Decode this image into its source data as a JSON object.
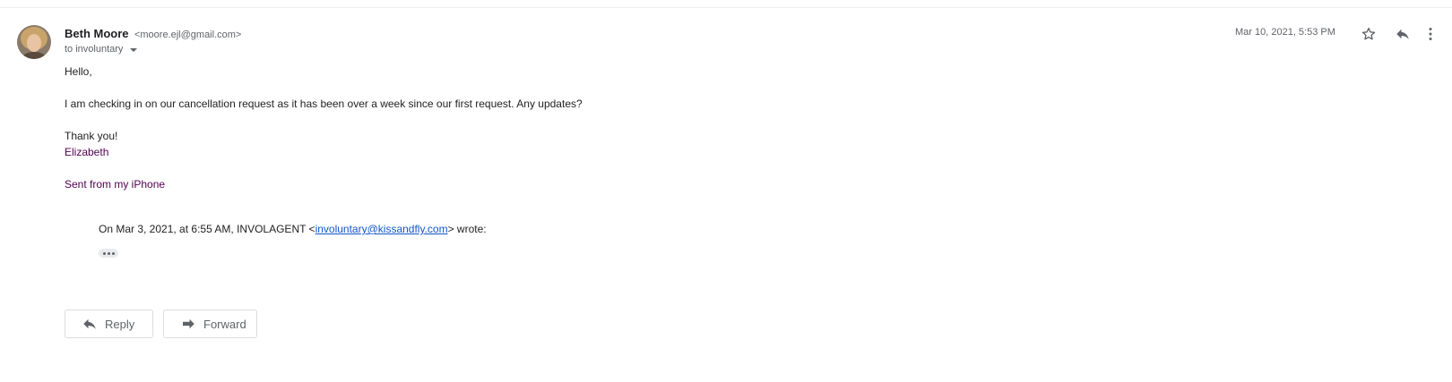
{
  "message": {
    "sender_name": "Beth Moore",
    "sender_email": "<moore.ejl@gmail.com>",
    "recipient": "to involuntary",
    "date": "Mar 10, 2021, 5:53 PM",
    "icons": {
      "avatar": "avatar",
      "star": "star-icon",
      "reply": "reply-icon",
      "more": "more-vert-icon",
      "recipient_caret": "chevron-down-icon"
    }
  },
  "body": {
    "greeting": "Hello,",
    "paragraph": "I am checking in on our cancellation request as it has been over a week since our first request. Any updates?",
    "thanks": "Thank you!",
    "signature_name": "Elizabeth",
    "sent_from": "Sent from my iPhone"
  },
  "quote": {
    "prefix": "On Mar 3, 2021, at 6:55 AM, INVOLAGENT <",
    "link_email": "involuntary@kissandfly.com",
    "suffix": "> wrote:"
  },
  "actions": {
    "reply_label": "Reply",
    "forward_label": "Forward"
  },
  "colors": {
    "signature_purple": "#500050",
    "link_blue": "#1155cc",
    "secondary_text": "#5f6368"
  }
}
